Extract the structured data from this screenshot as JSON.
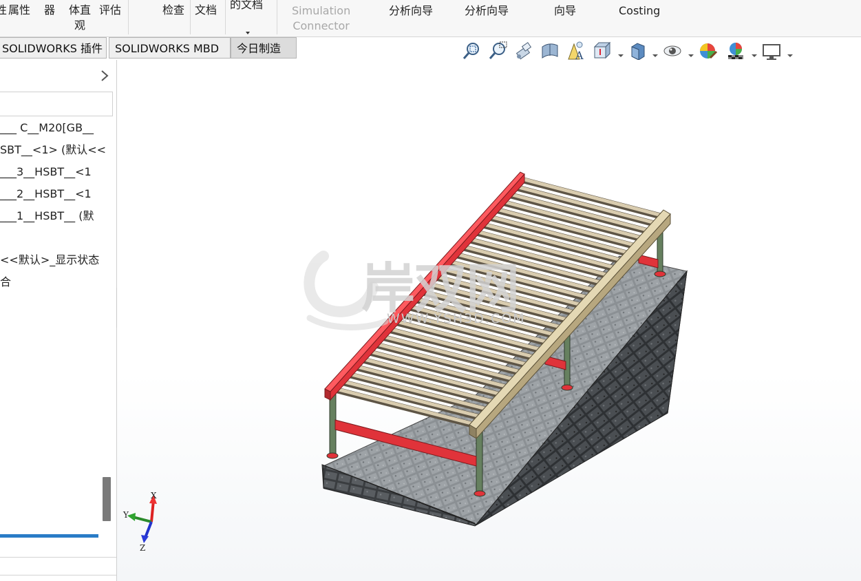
{
  "ribbon": {
    "items": [
      {
        "lines": [
          "性"
        ]
      },
      {
        "lines": [
          "属性"
        ]
      },
      {
        "lines": [
          "器"
        ]
      },
      {
        "lines": [
          "体直",
          "观"
        ]
      },
      {
        "lines": [
          "评估"
        ]
      },
      {
        "lines": [
          "检查"
        ]
      },
      {
        "lines": [
          "文档"
        ]
      },
      {
        "lines": [
          "的文档"
        ]
      },
      {
        "lines": [
          "Simulation",
          "Connector"
        ]
      },
      {
        "lines": [
          "分析向导"
        ]
      },
      {
        "lines": [
          "分析向导"
        ]
      },
      {
        "lines": [
          "向导"
        ]
      },
      {
        "lines": [
          "Costing"
        ]
      }
    ]
  },
  "tabs": [
    {
      "label": "SOLIDWORKS 插件"
    },
    {
      "label": "SOLIDWORKS MBD"
    },
    {
      "label": "今日制造"
    }
  ],
  "hud_icons": [
    "zoom-to-fit-icon",
    "zoom-to-area-icon",
    "previous-view-icon",
    "section-view-icon",
    "dynamic-annotation-icon",
    "view-orientation-icon",
    "display-style-icon",
    "hide-show-items-icon",
    "edit-appearance-icon",
    "apply-scene-icon",
    "view-settings-icon"
  ],
  "tree": {
    "items": [
      {
        "text": "___ C__M20[GB__"
      },
      {
        "text": "SBT__<1> (默认<<"
      },
      {
        "text": "___3__HSBT__<1"
      },
      {
        "text": "___2__HSBT__<1"
      },
      {
        "text": "___1__HSBT__ (默"
      },
      {
        "text": "<<默认>_显示状态"
      },
      {
        "text": "合"
      }
    ]
  },
  "watermark": {
    "text": "岸双网",
    "url": "WWW.YSH3D.COM"
  },
  "triad": {
    "x": "X",
    "y": "Y",
    "z": "Z"
  },
  "colors": {
    "rail_red": "#e0333a",
    "rail_tan": "#c8b890",
    "roller": "#b9ab8f",
    "leg": "#5f7a5a",
    "stone_top": "#8d9296",
    "stone_side": "#3c3f42",
    "accent_blue": "#2a7cc7"
  }
}
